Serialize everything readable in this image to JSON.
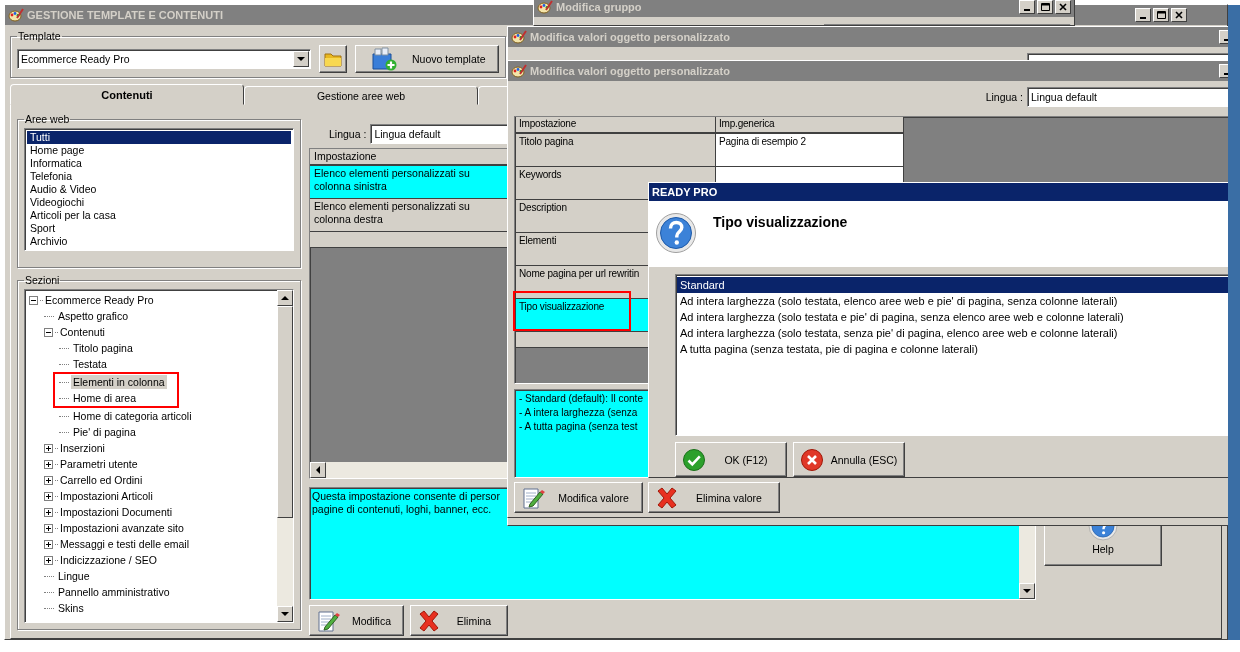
{
  "main_window": {
    "title": "GESTIONE TEMPLATE E CONTENUTI",
    "template_label": "Template",
    "template_value": "Ecommerce Ready Pro",
    "new_template_button": "Nuovo template",
    "tabs": [
      {
        "label": "Contenuti",
        "selected": true
      },
      {
        "label": "Gestione aree web",
        "selected": false
      },
      {
        "selected": false
      }
    ],
    "web_areas": {
      "title": "Aree web",
      "items": [
        {
          "label": "Tutti",
          "selected": true
        },
        {
          "label": "Home page",
          "selected": false
        },
        {
          "label": "Informatica",
          "selected": false
        },
        {
          "label": "Telefonia",
          "selected": false
        },
        {
          "label": "Audio & Video",
          "selected": false
        },
        {
          "label": "Videogiochi",
          "selected": false
        },
        {
          "label": "Articoli per la casa",
          "selected": false
        },
        {
          "label": "Sport",
          "selected": false
        },
        {
          "label": "Archivio",
          "selected": false
        }
      ]
    },
    "sections": {
      "title": "Sezioni",
      "tree": [
        {
          "label": "Ecommerce Ready Pro",
          "selected": false,
          "expanded": true,
          "children": [
            {
              "label": "Aspetto grafico",
              "selected": false
            },
            {
              "label": "Contenuti",
              "selected": false,
              "expanded": true,
              "children": [
                {
                  "label": "Titolo pagina",
                  "selected": false,
                  "framed": false
                },
                {
                  "label": "Testata",
                  "selected": false,
                  "framed": false
                },
                {
                  "label": "Elementi in colonna",
                  "selected": true,
                  "framed": true
                },
                {
                  "label": "Home di area",
                  "selected": false,
                  "framed": true
                },
                {
                  "label": "Home di categoria articoli",
                  "selected": false,
                  "framed": false
                },
                {
                  "label": "Pie' di pagina",
                  "selected": false,
                  "framed": false
                }
              ]
            },
            {
              "label": "Inserzioni",
              "selected": false,
              "expanded": false
            },
            {
              "label": "Parametri utente",
              "selected": false,
              "expanded": false
            },
            {
              "label": "Carrello ed Ordini",
              "selected": false,
              "expanded": false
            },
            {
              "label": "Impostazioni Articoli",
              "selected": false,
              "expanded": false
            },
            {
              "label": "Impostazioni Documenti",
              "selected": false,
              "expanded": false
            },
            {
              "label": "Impostazioni avanzate sito",
              "selected": false,
              "expanded": false
            },
            {
              "label": "Messaggi e testi delle email",
              "selected": false,
              "expanded": false
            },
            {
              "label": "Indicizzazione / SEO",
              "selected": false,
              "expanded": false
            },
            {
              "label": "Lingue",
              "selected": false
            },
            {
              "label": "Pannello amministrativo",
              "selected": false
            },
            {
              "label": "Skins",
              "selected": false
            }
          ]
        }
      ]
    },
    "language_label": "Lingua :",
    "language_value": "Lingua default",
    "settings_table": {
      "columns": [
        "Impostazione"
      ],
      "rows": [
        {
          "cells": [
            "Elenco elementi personalizzati su colonna sinistra"
          ],
          "selected": true
        },
        {
          "cells": [
            "Elenco elementi personalizzati su colonna destra"
          ],
          "selected": false
        }
      ]
    },
    "description_lines": [
      "Questa impostazione consente di persor",
      "pagine di contenuti, loghi, banner, ecc."
    ],
    "buttons": [
      {
        "label": "Modifica",
        "kind": "edit"
      },
      {
        "label": "Elimina",
        "kind": "delete"
      }
    ],
    "help_button": "Help"
  },
  "group_window": {
    "title": "Modifica gruppo"
  },
  "edit_windows": [
    {
      "title": "Modifica valori oggetto personalizzato"
    },
    {
      "title": "Modifica valori oggetto personalizzato",
      "language_label": "Lingua :",
      "language_value": "Lingua default",
      "table": {
        "columns": [
          "Impostazione",
          "Imp.generica"
        ],
        "rows": [
          {
            "cells": [
              "Titolo pagina",
              "Pagina di esempio 2"
            ],
            "selected": false,
            "framed": false
          },
          {
            "cells": [
              "Keywords"
            ],
            "selected": false,
            "framed": false
          },
          {
            "cells": [
              "Description"
            ],
            "selected": false,
            "framed": false
          },
          {
            "cells": [
              "Elementi"
            ],
            "selected": false,
            "framed": false
          },
          {
            "cells": [
              "Nome pagina per url rewritin"
            ],
            "selected": false,
            "framed": false
          },
          {
            "cells": [
              "Tipo visualizzazione"
            ],
            "selected": true,
            "framed": true
          }
        ]
      },
      "description_lines": [
        "- Standard (default): Il conte",
        "- A intera larghezza (senza",
        "- A tutta pagina (senza test"
      ],
      "buttons": [
        {
          "label": "Modifica valore",
          "kind": "edit"
        },
        {
          "label": "Elimina valore",
          "kind": "delete"
        }
      ]
    }
  ],
  "dialog": {
    "title": "READY PRO",
    "heading": "Tipo visualizzazione",
    "options": [
      {
        "label": "Standard",
        "selected": true
      },
      {
        "label": "Ad intera larghezza (solo testata, elenco aree web e pie' di pagina, senza colonne laterali)",
        "selected": false
      },
      {
        "label": "Ad intera larghezza (solo testata e pie' di pagina, senza elenco aree web e colonne laterali)",
        "selected": false
      },
      {
        "label": "Ad intera larghezza (solo testata, senza pie' di pagina, elenco aree web e colonne laterali)",
        "selected": false
      },
      {
        "label": "A tutta pagina (senza testata, pie di pagina e colonne laterali)",
        "selected": false
      }
    ],
    "buttons": [
      {
        "label": "OK (F12)",
        "kind": "ok"
      },
      {
        "label": "Annulla (ESC)",
        "kind": "cancel"
      }
    ]
  }
}
